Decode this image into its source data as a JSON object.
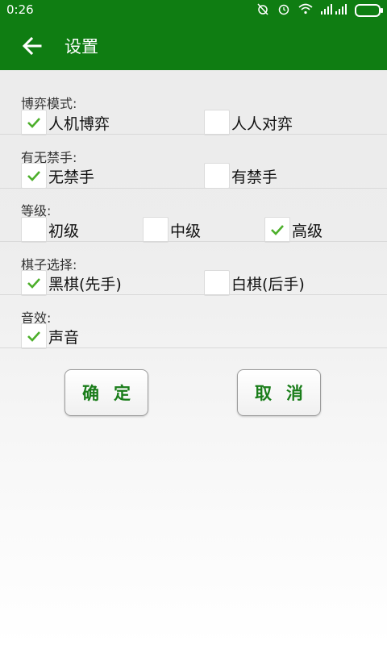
{
  "status_bar": {
    "time": "0:26",
    "icons": [
      "alarm-off-icon",
      "alarm-icon",
      "wifi-icon",
      "signal-icon",
      "battery-icon"
    ]
  },
  "toolbar": {
    "title": "设置",
    "back_icon": "back-arrow-icon"
  },
  "colors": {
    "brand": "#0f7d12",
    "check": "#4caf2a",
    "button_text": "#1a7d1a"
  },
  "sections": {
    "mode": {
      "label": "博弈模式:",
      "options": [
        {
          "label": "人机博弈",
          "checked": true
        },
        {
          "label": "人人对弈",
          "checked": false
        }
      ]
    },
    "forbidden": {
      "label": "有无禁手:",
      "options": [
        {
          "label": "无禁手",
          "checked": true
        },
        {
          "label": "有禁手",
          "checked": false
        }
      ]
    },
    "level": {
      "label": "等级:",
      "options": [
        {
          "label": "初级",
          "checked": false
        },
        {
          "label": "中级",
          "checked": false
        },
        {
          "label": "高级",
          "checked": true
        }
      ]
    },
    "piece": {
      "label": "棋子选择:",
      "options": [
        {
          "label": "黑棋(先手)",
          "checked": true
        },
        {
          "label": "白棋(后手)",
          "checked": false
        }
      ]
    },
    "sound": {
      "label": "音效:",
      "options": [
        {
          "label": "声音",
          "checked": true
        }
      ]
    }
  },
  "buttons": {
    "confirm": "确定",
    "cancel": "取消"
  }
}
